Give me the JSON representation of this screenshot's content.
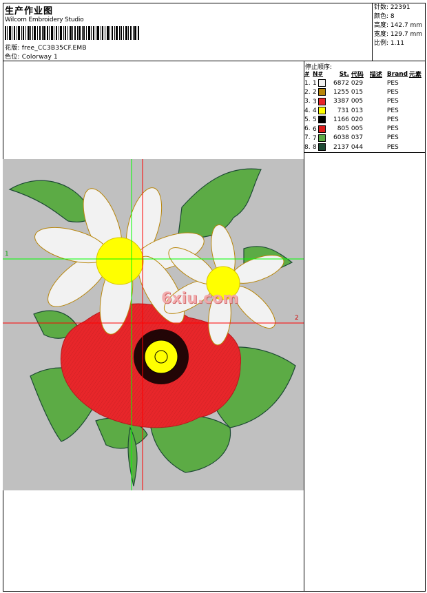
{
  "header": {
    "title": "生产作业图",
    "software": "Wilcom Embroidery Studio",
    "design_label": "花版: free_CC3B35CF.EMB",
    "colorway_label": "色位:  Colorway 1"
  },
  "stats": [
    {
      "label": "针数:",
      "value": "22391"
    },
    {
      "label": "颜色:",
      "value": "8"
    },
    {
      "label": "高度:",
      "value": "142.7 mm"
    },
    {
      "label": "宽度:",
      "value": "129.7 mm"
    },
    {
      "label": "比例:",
      "value": "1.11"
    }
  ],
  "stop_sequence": {
    "title": "停止顺序:",
    "headers": [
      "#",
      "N#",
      "St.",
      "代码",
      "描述",
      "Brand",
      "元素"
    ],
    "rows": [
      {
        "idx": "1.",
        "n": "1",
        "color": "#f2f2f2",
        "st": "6872",
        "code": "029",
        "brand": "PES"
      },
      {
        "idx": "2.",
        "n": "2",
        "color": "#b8860b",
        "st": "1255",
        "code": "015",
        "brand": "PES"
      },
      {
        "idx": "3.",
        "n": "3",
        "color": "#e8262a",
        "st": "3387",
        "code": "005",
        "brand": "PES"
      },
      {
        "idx": "4.",
        "n": "4",
        "color": "#ffff00",
        "st": "731",
        "code": "013",
        "brand": "PES"
      },
      {
        "idx": "5.",
        "n": "5",
        "color": "#000000",
        "st": "1166",
        "code": "020",
        "brand": "PES"
      },
      {
        "idx": "6.",
        "n": "6",
        "color": "#dd1a1a",
        "st": "805",
        "code": "005",
        "brand": "PES"
      },
      {
        "idx": "7.",
        "n": "7",
        "color": "#5cab45",
        "st": "6038",
        "code": "037",
        "brand": "PES"
      },
      {
        "idx": "8.",
        "n": "8",
        "color": "#1d4a34",
        "st": "2137",
        "code": "044",
        "brand": "PES"
      }
    ]
  },
  "preview": {
    "guide_labels": [
      "1",
      "2"
    ],
    "watermark": "6xiu.com"
  }
}
